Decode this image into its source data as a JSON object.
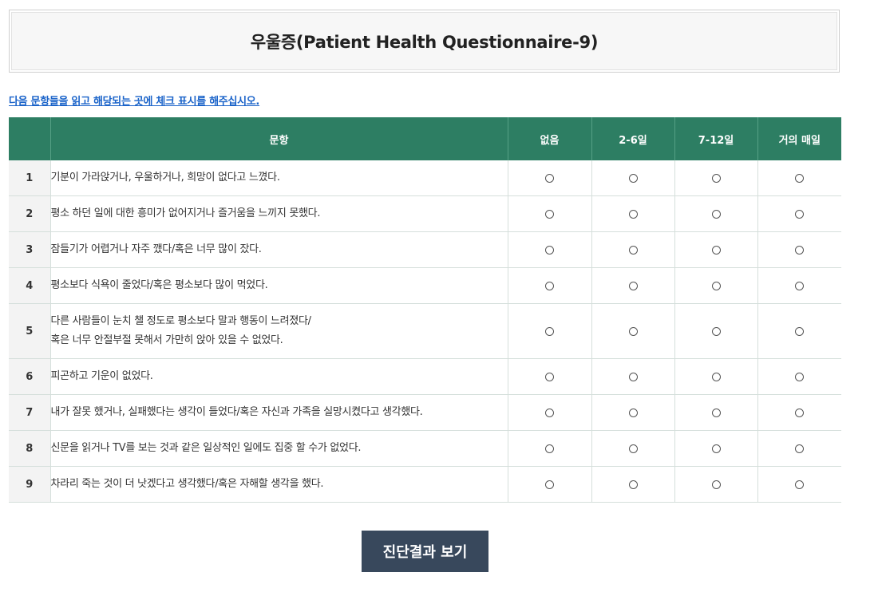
{
  "page": {
    "title": "우울증(Patient Health Questionnaire-9)",
    "instruction": "다음 문항들을 읽고 해당되는 곳에 체크 표시를 해주십시오."
  },
  "table": {
    "headers": {
      "number": "",
      "question": "문항",
      "options": [
        "없음",
        "2-6일",
        "7-12일",
        "거의 매일"
      ]
    },
    "rows": [
      {
        "num": "1",
        "lines": [
          "기분이 가라앉거나, 우울하거나, 희망이 없다고 느꼈다."
        ]
      },
      {
        "num": "2",
        "lines": [
          "평소 하던 일에 대한 흥미가 없어지거나 즐거움을 느끼지 못했다."
        ]
      },
      {
        "num": "3",
        "lines": [
          "잠들기가 어렵거나 자주 깼다/혹은 너무 많이 잤다."
        ]
      },
      {
        "num": "4",
        "lines": [
          "평소보다 식욕이 줄었다/혹은 평소보다 많이 먹었다."
        ]
      },
      {
        "num": "5",
        "lines": [
          "다른 사람들이 눈치 챌 정도로 평소보다 말과 행동이 느려졌다/",
          "혹은 너무 안절부절 못해서 가만히 앉아 있을 수 없었다."
        ]
      },
      {
        "num": "6",
        "lines": [
          "피곤하고 기운이 없었다."
        ]
      },
      {
        "num": "7",
        "lines": [
          "내가 잘못 했거나, 실패했다는 생각이 들었다/혹은 자신과 가족을 실망시켰다고 생각했다."
        ]
      },
      {
        "num": "8",
        "lines": [
          "신문을 읽거나 TV를 보는 것과 같은 일상적인 일에도 집중 할 수가 없었다."
        ]
      },
      {
        "num": "9",
        "lines": [
          "차라리 죽는 것이 더 낫겠다고 생각했다/혹은 자해할 생각을 했다."
        ]
      }
    ]
  },
  "submit": {
    "label": "진단결과 보기"
  },
  "colors": {
    "header_bg": "#2d7e63",
    "instruction_link": "#1a63c9",
    "button_bg": "#38485c",
    "number_cell_bg": "#f3f3f3"
  }
}
